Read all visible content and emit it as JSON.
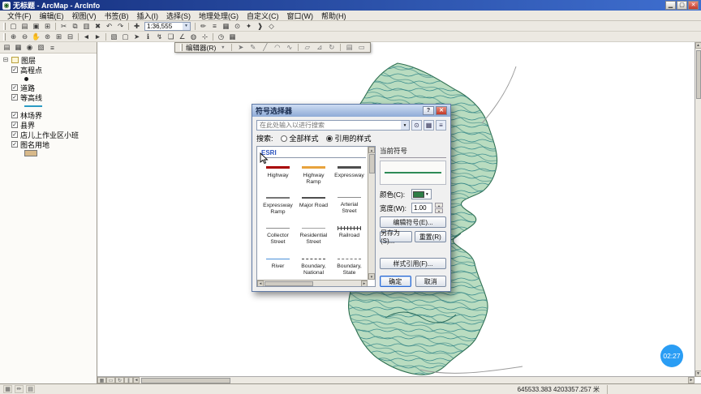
{
  "glyphs": {
    "dropdown": "▾",
    "spin_up": "▴",
    "spin_down": "▾",
    "up": "▲",
    "down": "▼",
    "left": "◄",
    "right": "►",
    "close": "✕",
    "help": "?",
    "minimize": "▁",
    "maximize": "▢",
    "check": "✓",
    "collapse": "⊟",
    "menu_arrow": "▼",
    "app": "◉"
  },
  "window": {
    "title": "无标题 - ArcMap - ArcInfo"
  },
  "menu": {
    "items": [
      "文件(F)",
      "编辑(E)",
      "视图(V)",
      "书签(B)",
      "插入(I)",
      "选择(S)",
      "地理处理(G)",
      "自定义(C)",
      "窗口(W)",
      "帮助(H)"
    ]
  },
  "toolbar1": {
    "scale_value": "1:36,555",
    "icons": [
      {
        "name": "new-document",
        "glyph": "▢"
      },
      {
        "name": "open-folder",
        "glyph": "▤"
      },
      {
        "name": "save",
        "glyph": "▣"
      },
      {
        "name": "print",
        "glyph": "⊞"
      },
      {
        "name": "cut",
        "glyph": "✂"
      },
      {
        "name": "copy",
        "glyph": "⧉"
      },
      {
        "name": "paste",
        "glyph": "▥"
      },
      {
        "name": "delete",
        "glyph": "✖"
      },
      {
        "name": "undo",
        "glyph": "↶"
      },
      {
        "name": "redo",
        "glyph": "↷"
      },
      {
        "name": "add-data",
        "glyph": "✚"
      }
    ],
    "icons_right": [
      {
        "name": "editor-toolbar-toggle",
        "glyph": "✏"
      },
      {
        "name": "table-of-contents",
        "glyph": "≡"
      },
      {
        "name": "catalog-window",
        "glyph": "▦"
      },
      {
        "name": "search-window",
        "glyph": "⊙"
      },
      {
        "name": "arctoolbox",
        "glyph": "✦"
      },
      {
        "name": "python-window",
        "glyph": "❱"
      },
      {
        "name": "model-builder",
        "glyph": "◇"
      }
    ]
  },
  "toolbar2": {
    "icons": [
      {
        "name": "zoom-in",
        "glyph": "⊕"
      },
      {
        "name": "zoom-out",
        "glyph": "⊖"
      },
      {
        "name": "pan",
        "glyph": "✋"
      },
      {
        "name": "full-extent",
        "glyph": "⊛"
      },
      {
        "name": "fixed-zoom-in",
        "glyph": "⊞"
      },
      {
        "name": "fixed-zoom-out",
        "glyph": "⊟"
      },
      {
        "name": "go-back-extent",
        "glyph": "◄"
      },
      {
        "name": "go-forward-extent",
        "glyph": "►"
      },
      {
        "name": "select-features",
        "glyph": "▧"
      },
      {
        "name": "clear-selection",
        "glyph": "▢"
      },
      {
        "name": "select-elements",
        "glyph": "➤"
      },
      {
        "name": "identify",
        "glyph": "ℹ"
      },
      {
        "name": "hyperlink",
        "glyph": "↯"
      },
      {
        "name": "html-popup",
        "glyph": "❏"
      },
      {
        "name": "measure",
        "glyph": "∠"
      },
      {
        "name": "find",
        "glyph": "◍"
      },
      {
        "name": "go-to-xy",
        "glyph": "⊹"
      },
      {
        "name": "time-slider",
        "glyph": "◷"
      },
      {
        "name": "attribute-table",
        "glyph": "▦"
      }
    ]
  },
  "editor_toolbar": {
    "label": "编辑器(R)",
    "icons": [
      {
        "name": "edit-tool",
        "glyph": "➤"
      },
      {
        "name": "edit-annotation",
        "glyph": "✎"
      },
      {
        "name": "straight-segment",
        "glyph": "╱"
      },
      {
        "name": "endpoint-arc",
        "glyph": "◠"
      },
      {
        "name": "trace",
        "glyph": "∿"
      },
      {
        "name": "edit-vertices",
        "glyph": "▱"
      },
      {
        "name": "reshape-feature",
        "glyph": "⊿"
      },
      {
        "name": "rotate-tool",
        "glyph": "↻"
      },
      {
        "name": "attributes-window",
        "glyph": "▤"
      },
      {
        "name": "sketch-properties",
        "glyph": "▭"
      }
    ]
  },
  "toc": {
    "header_icons": [
      {
        "name": "list-by-drawing-order",
        "glyph": "▤"
      },
      {
        "name": "list-by-source",
        "glyph": "▦"
      },
      {
        "name": "list-by-visibility",
        "glyph": "◉"
      },
      {
        "name": "list-by-selection",
        "glyph": "▧"
      },
      {
        "name": "toc-options",
        "glyph": "≡"
      }
    ],
    "root": "图层",
    "layers": [
      {
        "label": "高程点",
        "checked": true,
        "symbol": "point",
        "color": "#1a1a1a"
      },
      {
        "label": "道路",
        "checked": true
      },
      {
        "label": "等高线",
        "checked": true,
        "symbol": "line",
        "color": "#2b9bc4"
      },
      {
        "label": "林场界",
        "checked": true
      },
      {
        "label": "县界",
        "checked": true
      },
      {
        "label": "店儿上作业区小班",
        "checked": true
      },
      {
        "label": "图名用地",
        "checked": true,
        "symbol": "fill",
        "color": "#d8b98a"
      }
    ]
  },
  "dialog": {
    "title": "符号选择器",
    "search_placeholder": "在此处输入以进行搜索",
    "search_label": "搜索:",
    "radio_all": "全部样式",
    "radio_referenced": "引用的样式",
    "group": "ESRI",
    "symbols": [
      {
        "name": "Highway",
        "color": "#a80000",
        "weight": "3px",
        "style": "solid"
      },
      {
        "name": "Highway Ramp",
        "color": "#e8a33d",
        "weight": "3px",
        "style": "solid"
      },
      {
        "name": "Expressway",
        "color": "#4e4e4e",
        "weight": "3px",
        "style": "solid"
      },
      {
        "name": "Expressway Ramp",
        "color": "#767676",
        "weight": "2px",
        "style": "solid"
      },
      {
        "name": "Major Road",
        "color": "#4e4e4e",
        "weight": "2px",
        "style": "solid"
      },
      {
        "name": "Arterial Street",
        "color": "#8c8c8c",
        "weight": "1px",
        "style": "solid"
      },
      {
        "name": "Collector Street",
        "color": "#8c8c8c",
        "weight": "1px",
        "style": "solid"
      },
      {
        "name": "Residential Street",
        "color": "#a2a2a2",
        "weight": "1px",
        "style": "solid"
      },
      {
        "name": "Railroad",
        "color": "#3c3c3c",
        "weight": "1px",
        "style": "rail"
      },
      {
        "name": "River",
        "color": "#4a90d9",
        "weight": "1px",
        "style": "solid"
      },
      {
        "name": "Boundary, National",
        "color": "#3c3c3c",
        "weight": "1px",
        "style": "dashed"
      },
      {
        "name": "Boundary, State",
        "color": "#6e6e6e",
        "weight": "1px",
        "style": "dashed"
      }
    ],
    "current": {
      "label": "当前符号",
      "color_label": "颜色(C):",
      "width_label": "宽度(W):",
      "width_value": "1.00",
      "preview_color": "#2e8b57",
      "swatch_color": "#2e7d46"
    },
    "buttons": {
      "edit_symbol": "编辑符号(E)...",
      "save_as": "另存为(S)...",
      "reset": "重置(R)",
      "style_references": "样式引用(F)...",
      "ok": "确定",
      "cancel": "取消"
    }
  },
  "statusbar": {
    "coordinates": "645533.383 4203357.257 米"
  },
  "overlay": {
    "timestamp": "02:27"
  },
  "map": {
    "colors": {
      "fill": "#b9dcc0",
      "contour": "#3f8f8f",
      "outline": "#2f6f50",
      "road": "#9a9a9a"
    }
  }
}
